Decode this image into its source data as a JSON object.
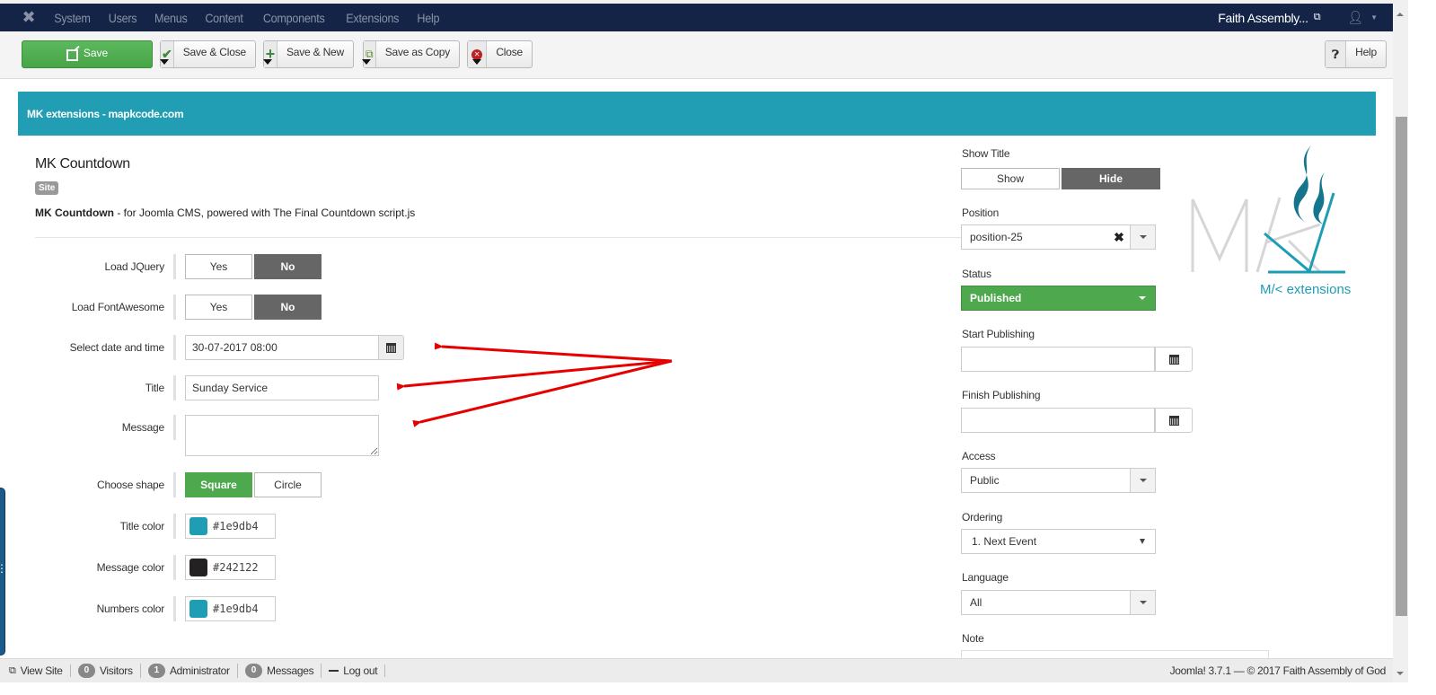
{
  "navbar": {
    "logo_icon": "joomla-logo-icon",
    "menu": [
      "System",
      "Users",
      "Menus",
      "Content",
      "Components",
      "Extensions",
      "Help"
    ],
    "site_name": "Faith Assembly...",
    "site_link_icon": "external-link-icon",
    "user_icon": "user-icon"
  },
  "toolbar": {
    "save": "Save",
    "save_close": "Save & Close",
    "save_new": "Save & New",
    "save_copy": "Save as Copy",
    "close": "Close",
    "help": "Help"
  },
  "banner": {
    "text": "MK extensions - mapkcode.com"
  },
  "module": {
    "title": "MK Countdown",
    "badge": "Site",
    "desc_bold": "MK Countdown",
    "desc_rest": " - for Joomla CMS, powered with The Final Countdown script.js"
  },
  "form": {
    "load_jquery": {
      "label": "Load JQuery",
      "options": [
        "Yes",
        "No"
      ],
      "selected": "No"
    },
    "load_fontawesome": {
      "label": "Load FontAwesome",
      "options": [
        "Yes",
        "No"
      ],
      "selected": "No"
    },
    "datetime": {
      "label": "Select date and time",
      "value": "30-07-2017 08:00"
    },
    "title": {
      "label": "Title",
      "value": "Sunday Service"
    },
    "message": {
      "label": "Message",
      "value": ""
    },
    "shape": {
      "label": "Choose shape",
      "options": [
        "Square",
        "Circle"
      ],
      "selected": "Square"
    },
    "title_color": {
      "label": "Title color",
      "value": "#1e9db4"
    },
    "message_color": {
      "label": "Message color",
      "value": "#242122"
    },
    "numbers_color": {
      "label": "Numbers color",
      "value": "#1e9db4"
    }
  },
  "sidebar": {
    "show_title": {
      "label": "Show Title",
      "options": [
        "Show",
        "Hide"
      ],
      "selected": "Hide"
    },
    "position": {
      "label": "Position",
      "value": "position-25"
    },
    "status": {
      "label": "Status",
      "value": "Published"
    },
    "start_publishing": {
      "label": "Start Publishing",
      "value": ""
    },
    "finish_publishing": {
      "label": "Finish Publishing",
      "value": ""
    },
    "access": {
      "label": "Access",
      "value": "Public"
    },
    "ordering": {
      "label": "Ordering",
      "value": "1. Next Event"
    },
    "language": {
      "label": "Language",
      "value": "All"
    },
    "note": {
      "label": "Note",
      "value": ""
    }
  },
  "logo": {
    "text": "M/< extensions",
    "color": "#1e9db4"
  },
  "annotation": {
    "arrow_color": "#e60000"
  },
  "footer": {
    "view_site": "View Site",
    "visitors_count": "0",
    "visitors": "Visitors",
    "admin_count": "1",
    "admin": "Administrator",
    "messages_count": "0",
    "messages": "Messages",
    "logout": "Log out",
    "copyright": "Joomla! 3.7.1 — © 2017 Faith Assembly of God"
  },
  "colors": {
    "navbar": "#132446",
    "banner": "#219db4",
    "success": "#4ea84e",
    "toggle_active": "#666666"
  }
}
